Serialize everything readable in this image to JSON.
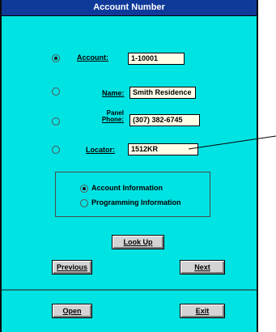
{
  "title": "Account Number",
  "search": {
    "account": {
      "label": "Account:",
      "value": "1-10001",
      "selected": true
    },
    "name": {
      "label": "Name:",
      "value": "Smith Residence",
      "selected": false
    },
    "panel_phone": {
      "label_line1": "Panel",
      "label_line2": "Phone:",
      "value": "(307) 382-6745",
      "selected": false
    },
    "locator": {
      "label": "Locator:",
      "value": "1512KR",
      "selected": false
    }
  },
  "info_options": [
    {
      "label": "Account Information",
      "selected": true
    },
    {
      "label": "Programming Information",
      "selected": false
    }
  ],
  "buttons": {
    "lookup": "Look Up",
    "previous": "Previous",
    "next": "Next",
    "open": "Open",
    "exit": "Exit"
  },
  "colors": {
    "dialog_bg": "#00e3e3",
    "titlebar": "#103a9a",
    "field_bg": "#ffffe8",
    "button_bg": "#d3d3d3"
  }
}
